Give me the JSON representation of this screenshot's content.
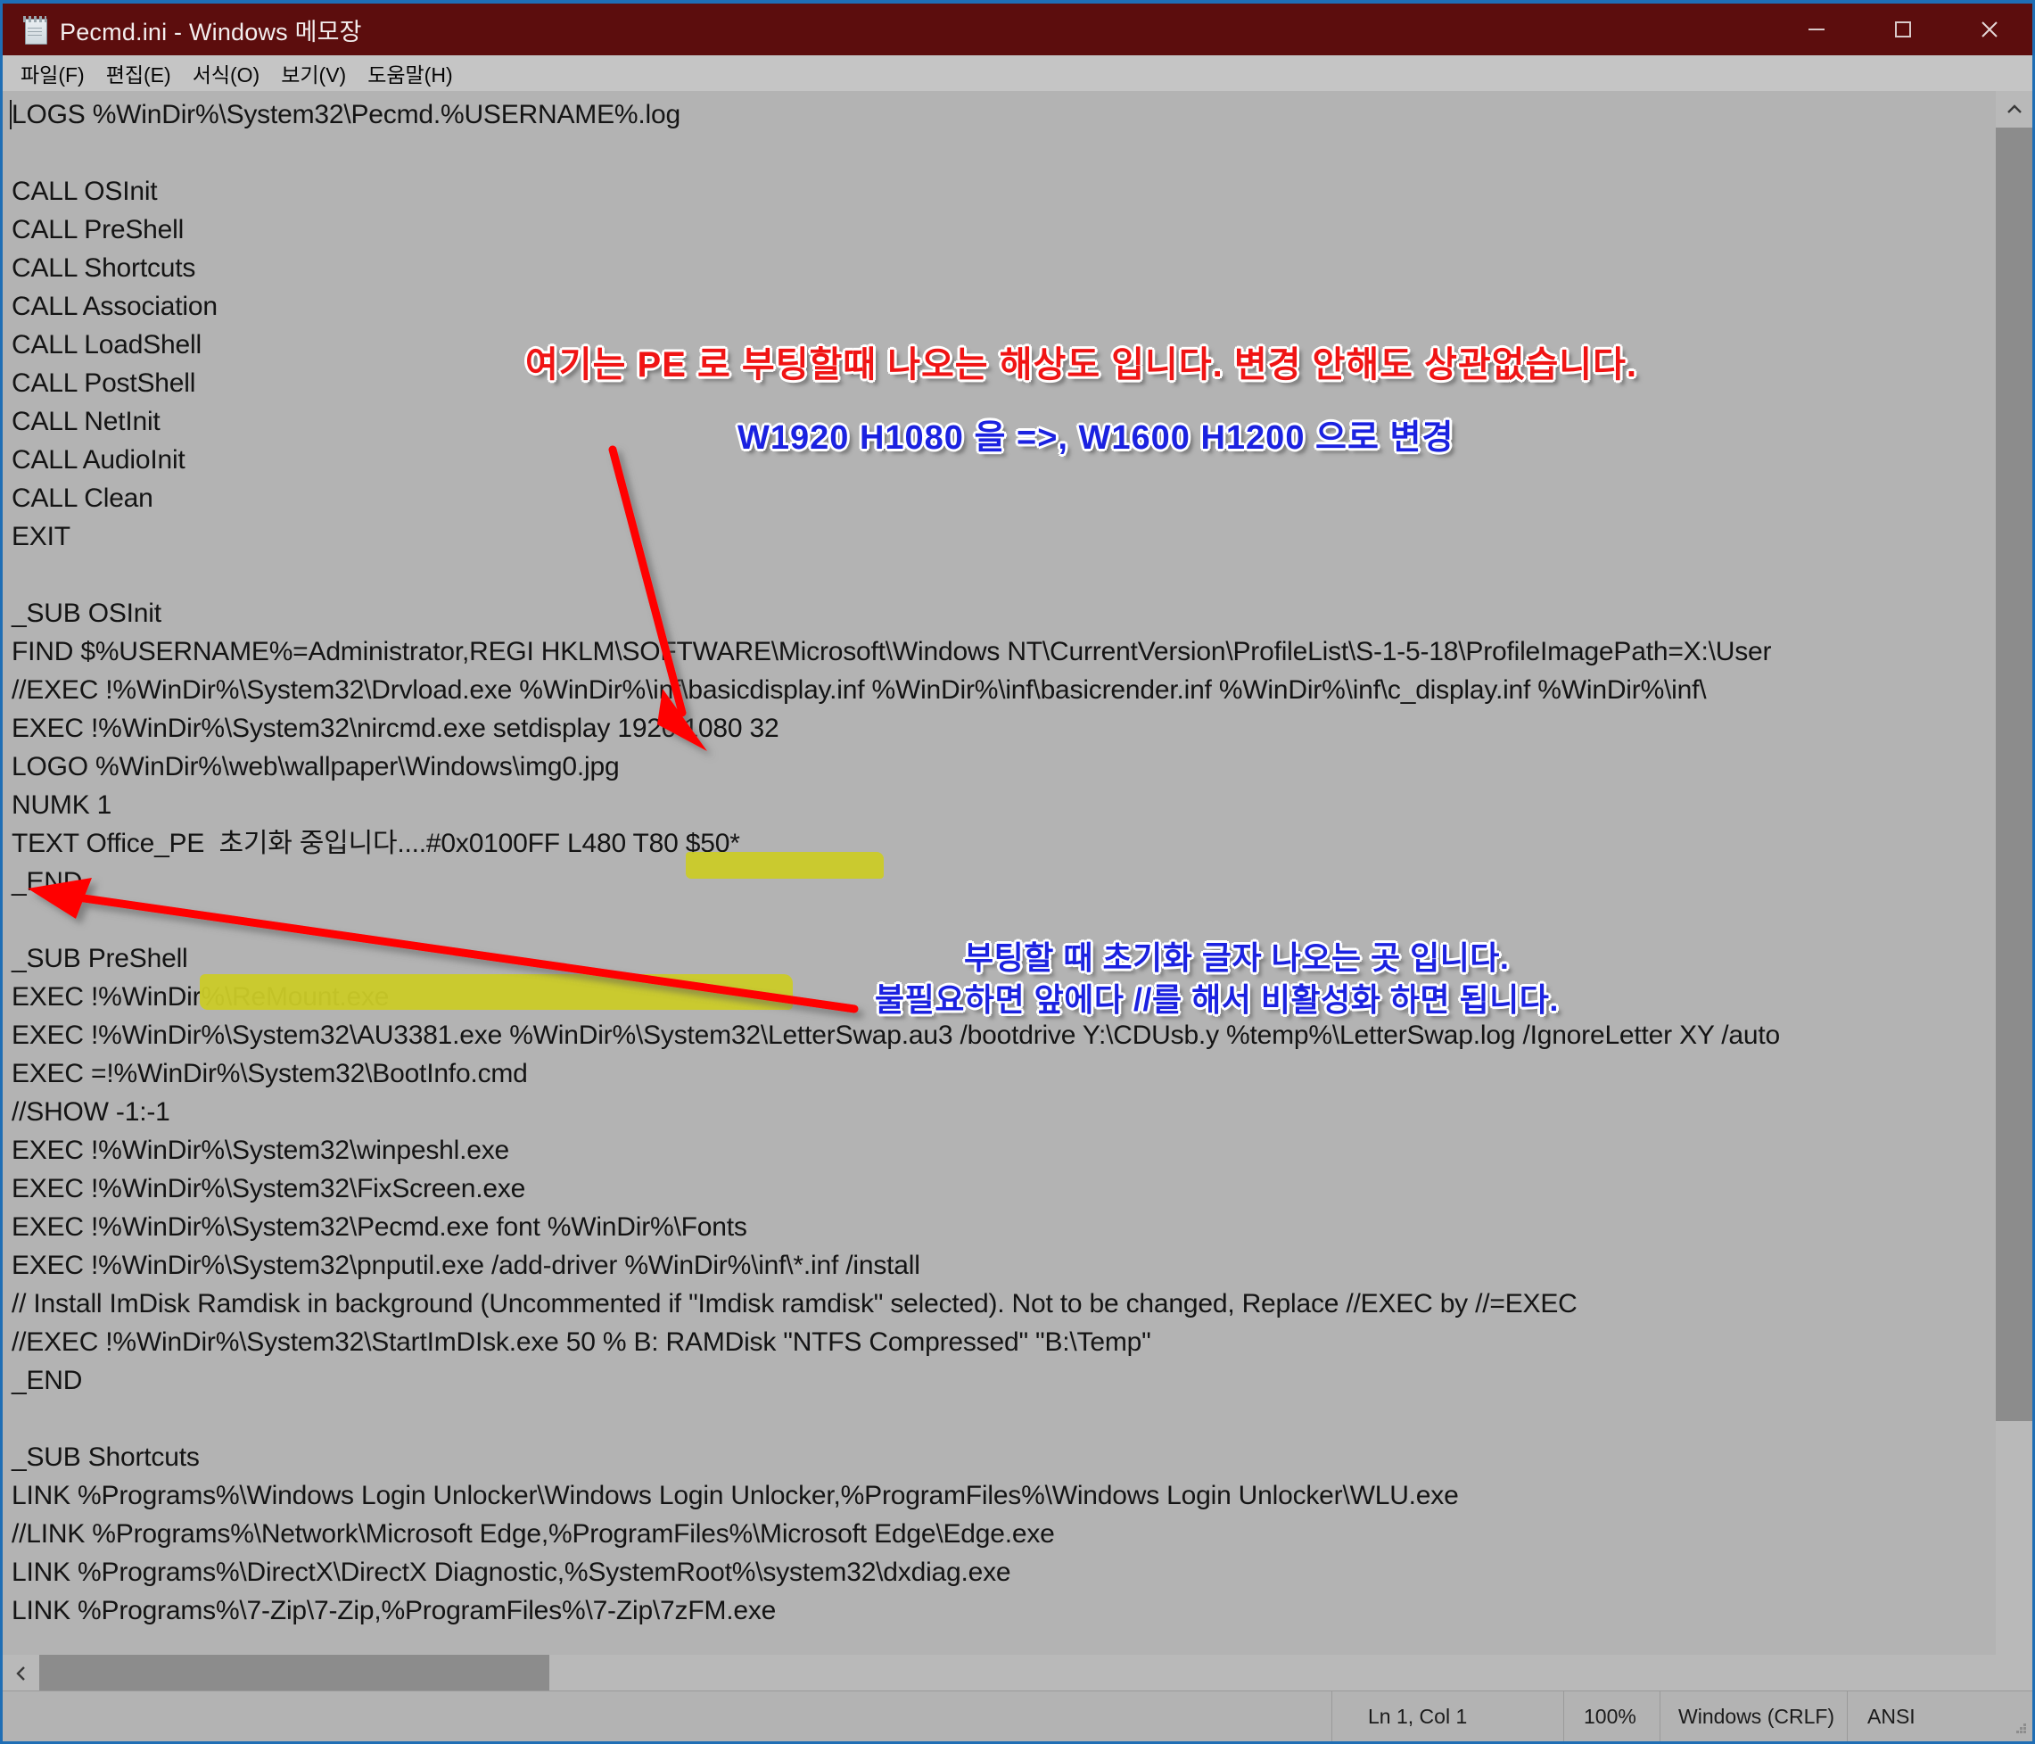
{
  "window": {
    "title": "Pecmd.ini - Windows 메모장",
    "icon": "notepad-icon",
    "controls": {
      "minimize": "minimize-icon",
      "maximize": "maximize-icon",
      "close": "close-icon"
    }
  },
  "menubar": {
    "items": [
      {
        "label": "파일(F)",
        "name": "menu-file"
      },
      {
        "label": "편집(E)",
        "name": "menu-edit"
      },
      {
        "label": "서식(O)",
        "name": "menu-format"
      },
      {
        "label": "보기(V)",
        "name": "menu-view"
      },
      {
        "label": "도움말(H)",
        "name": "menu-help"
      }
    ]
  },
  "editor": {
    "lines": [
      "LOGS %WinDir%\\System32\\Pecmd.%USERNAME%.log",
      "",
      "CALL OSInit",
      "CALL PreShell",
      "CALL Shortcuts",
      "CALL Association",
      "CALL LoadShell",
      "CALL PostShell",
      "CALL NetInit",
      "CALL AudioInit",
      "CALL Clean",
      "EXIT",
      "",
      "_SUB OSInit",
      "FIND $%USERNAME%=Administrator,REGI HKLM\\SOFTWARE\\Microsoft\\Windows NT\\CurrentVersion\\ProfileList\\S-1-5-18\\ProfileImagePath=X:\\User",
      "//EXEC !%WinDir%\\System32\\Drvload.exe %WinDir%\\inf\\basicdisplay.inf %WinDir%\\inf\\basicrender.inf %WinDir%\\inf\\c_display.inf %WinDir%\\inf\\",
      "EXEC !%WinDir%\\System32\\nircmd.exe setdisplay 1920 1080 32",
      "LOGO %WinDir%\\web\\wallpaper\\Windows\\img0.jpg",
      "NUMK 1",
      "TEXT Office_PE  초기화 중입니다....#0x0100FF L480 T80 $50*",
      "_END",
      "",
      "_SUB PreShell",
      "EXEC !%WinDir%\\ReMount.exe",
      "EXEC !%WinDir%\\System32\\AU3381.exe %WinDir%\\System32\\LetterSwap.au3 /bootdrive Y:\\CDUsb.y %temp%\\LetterSwap.log /IgnoreLetter XY /auto",
      "EXEC =!%WinDir%\\System32\\BootInfo.cmd",
      "//SHOW -1:-1",
      "EXEC !%WinDir%\\System32\\winpeshl.exe",
      "EXEC !%WinDir%\\System32\\FixScreen.exe",
      "EXEC !%WinDir%\\System32\\Pecmd.exe font %WinDir%\\Fonts",
      "EXEC !%WinDir%\\System32\\pnputil.exe /add-driver %WinDir%\\inf\\*.inf /install",
      "// Install ImDisk Ramdisk in background (Uncommented if \"Imdisk ramdisk\" selected). Not to be changed, Replace //EXEC by //=EXEC",
      "//EXEC !%WinDir%\\System32\\StartImDIsk.exe 50 % B: RAMDisk \"NTFS Compressed\" \"B:\\Temp\"",
      "_END",
      "",
      "_SUB Shortcuts",
      "LINK %Programs%\\Windows Login Unlocker\\Windows Login Unlocker,%ProgramFiles%\\Windows Login Unlocker\\WLU.exe",
      "//LINK %Programs%\\Network\\Microsoft Edge,%ProgramFiles%\\Microsoft Edge\\Edge.exe",
      "LINK %Programs%\\DirectX\\DirectX Diagnostic,%SystemRoot%\\system32\\dxdiag.exe",
      "LINK %Programs%\\7-Zip\\7-Zip,%ProgramFiles%\\7-Zip\\7zFM.exe"
    ]
  },
  "annotations": {
    "red_note": "여기는 PE 로 부팅할때 나오는 해상도 입니다. 변경 안해도 상관없습니다.",
    "blue_note_1": "W1920 H1080 을 =>, W1600 H1200 으로 변경",
    "blue_note_2_line1": "부팅할 때  초기화 글자 나오는 곳 입니다.",
    "blue_note_2_line2": "불필요하면 앞에다 //를 해서  비활성화 하면 됩니다.",
    "colors": {
      "red": "#f01414",
      "blue": "#1b22e0",
      "highlighter": "#cbcb28",
      "arrow": "#ff0000"
    }
  },
  "statusbar": {
    "position": "Ln 1, Col 1",
    "zoom": "100%",
    "line_ending": "Windows (CRLF)",
    "encoding": "ANSI"
  },
  "scrollbars": {
    "vertical_up": "chevron-up-icon",
    "horizontal_left": "chevron-left-icon"
  }
}
